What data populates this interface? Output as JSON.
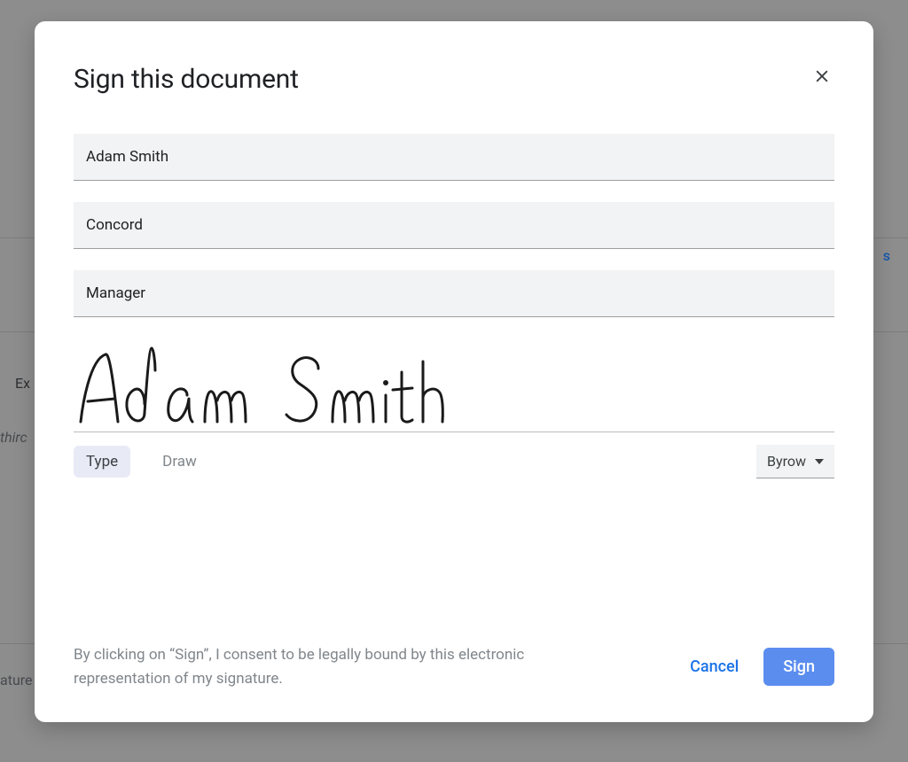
{
  "modal": {
    "title": "Sign this document",
    "fields": {
      "name": "Adam Smith",
      "company": "Concord",
      "role": "Manager"
    },
    "signature": {
      "typed_name": "Adam Smith",
      "tabs": {
        "type": "Type",
        "draw": "Draw"
      },
      "font_selected": "Byrow"
    },
    "consent": "By clicking on “Sign”, I consent to be legally bound by this electronic representation of my signature.",
    "actions": {
      "cancel": "Cancel",
      "sign": "Sign"
    }
  },
  "background": {
    "ex": "Ex",
    "third": "thirc",
    "ature": "ature",
    "s": "s"
  }
}
